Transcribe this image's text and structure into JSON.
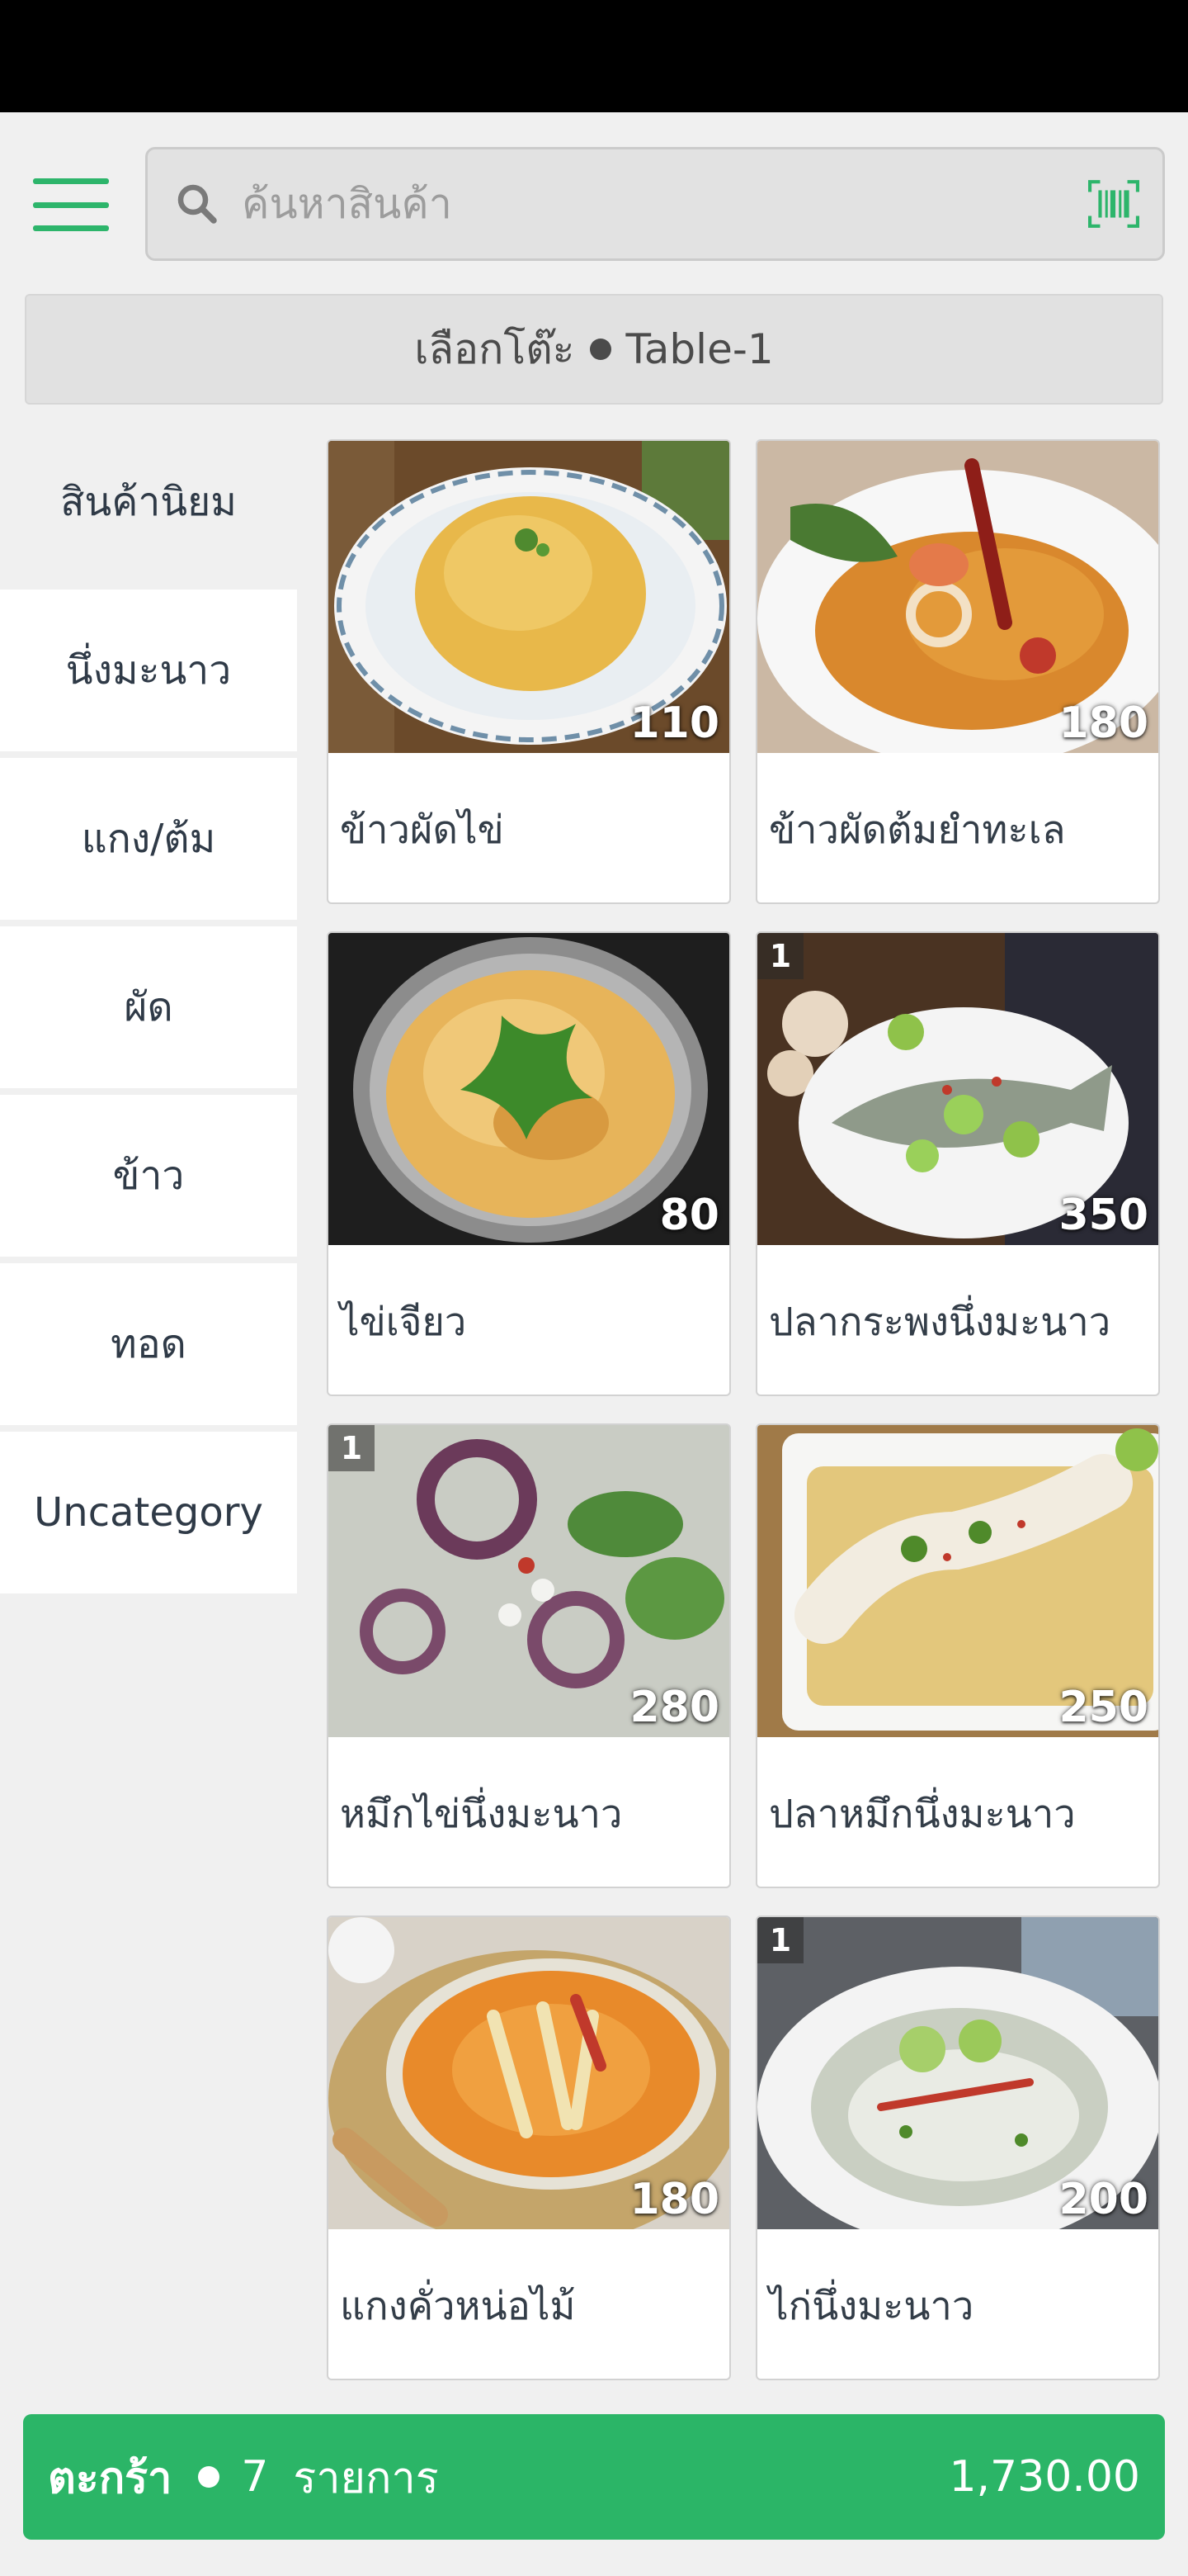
{
  "search": {
    "placeholder": "ค้นหาสินค้า"
  },
  "table_selector": {
    "label": "เลือกโต๊ะ",
    "table": "Table-1"
  },
  "categories": [
    {
      "label": "สินค้านิยม"
    },
    {
      "label": "นึ่งมะนาว"
    },
    {
      "label": "แกง/ต้ม"
    },
    {
      "label": "ผัด"
    },
    {
      "label": "ข้าว"
    },
    {
      "label": "ทอด"
    },
    {
      "label": "Uncategory"
    }
  ],
  "products": [
    {
      "name": "ข้าวผัดไข่",
      "price": "110",
      "qty": ""
    },
    {
      "name": "ข้าวผัดต้มยำทะเล",
      "price": "180",
      "qty": ""
    },
    {
      "name": "ไข่เจียว",
      "price": "80",
      "qty": ""
    },
    {
      "name": "ปลากระพงนึ่งมะนาว",
      "price": "350",
      "qty": "1"
    },
    {
      "name": "หมึกไข่นึ่งมะนาว",
      "price": "280",
      "qty": "1"
    },
    {
      "name": "ปลาหมึกนึ่งมะนาว",
      "price": "250",
      "qty": ""
    },
    {
      "name": "แกงคั่วหน่อไม้",
      "price": "180",
      "qty": ""
    },
    {
      "name": "ไก่นึ่งมะนาว",
      "price": "200",
      "qty": "1"
    }
  ],
  "cart": {
    "label": "ตะกร้า",
    "count": "7",
    "unit": "รายการ",
    "total": "1,730.00"
  },
  "colors": {
    "accent": "#2bb567",
    "background": "#f0f0f0"
  },
  "icons": {
    "menu": "hamburger-icon",
    "search": "search-icon",
    "barcode": "barcode-icon"
  }
}
